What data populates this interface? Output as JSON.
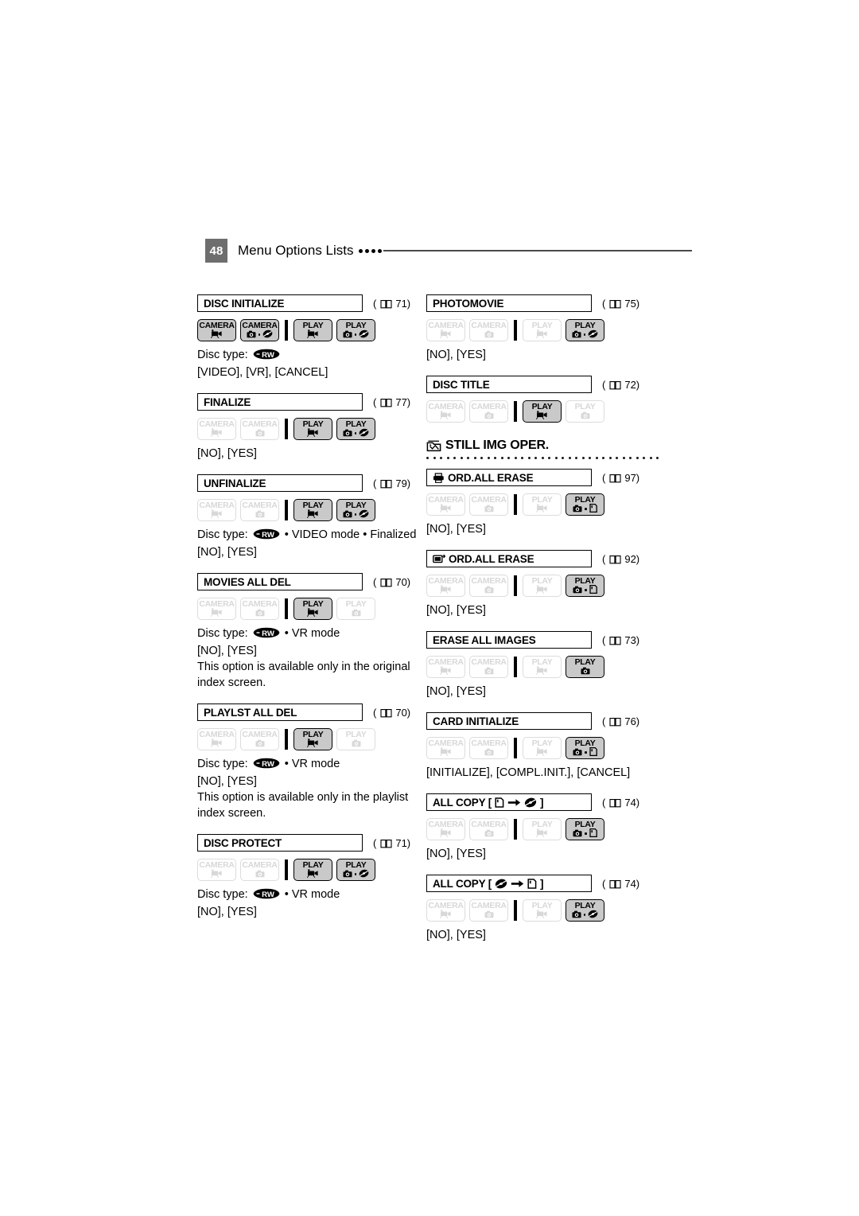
{
  "header": {
    "page_number": "48",
    "title": "Menu Options Lists",
    "dots": 4
  },
  "left_column": [
    {
      "id": "disc-initialize",
      "title": "DISC INITIALIZE",
      "ref": "71",
      "modes": [
        {
          "label": "CAMERA",
          "icons": [
            "movie"
          ],
          "enabled": true
        },
        {
          "label": "CAMERA",
          "icons": [
            "still",
            "disc"
          ],
          "enabled": true
        },
        {
          "label": "PLAY",
          "icons": [
            "movie"
          ],
          "enabled": true
        },
        {
          "label": "PLAY",
          "icons": [
            "still",
            "disc"
          ],
          "enabled": true
        }
      ],
      "lines": [
        {
          "type": "disctype",
          "prefix": "Disc type:",
          "disc": "-RW",
          "suffix": ""
        },
        {
          "type": "text",
          "text": "[VIDEO], [VR], [CANCEL]"
        }
      ]
    },
    {
      "id": "finalize",
      "title": "FINALIZE",
      "ref": "77",
      "modes": [
        {
          "label": "CAMERA",
          "icons": [
            "movie"
          ],
          "enabled": false
        },
        {
          "label": "CAMERA",
          "icons": [
            "still"
          ],
          "enabled": false
        },
        {
          "label": "PLAY",
          "icons": [
            "movie"
          ],
          "enabled": true
        },
        {
          "label": "PLAY",
          "icons": [
            "still",
            "disc"
          ],
          "enabled": true
        }
      ],
      "lines": [
        {
          "type": "text",
          "text": "[NO], [YES]"
        }
      ]
    },
    {
      "id": "unfinalize",
      "title": "UNFINALIZE",
      "ref": "79",
      "modes": [
        {
          "label": "CAMERA",
          "icons": [
            "movie"
          ],
          "enabled": false
        },
        {
          "label": "CAMERA",
          "icons": [
            "still"
          ],
          "enabled": false
        },
        {
          "label": "PLAY",
          "icons": [
            "movie"
          ],
          "enabled": true
        },
        {
          "label": "PLAY",
          "icons": [
            "still",
            "disc"
          ],
          "enabled": true
        }
      ],
      "lines": [
        {
          "type": "disctype",
          "prefix": "Disc type:",
          "disc": "-RW",
          "suffix": "• VIDEO mode • Finalized"
        },
        {
          "type": "text",
          "text": "[NO], [YES]"
        }
      ]
    },
    {
      "id": "movies-all-del",
      "title": "MOVIES ALL DEL",
      "ref": "70",
      "modes": [
        {
          "label": "CAMERA",
          "icons": [
            "movie"
          ],
          "enabled": false
        },
        {
          "label": "CAMERA",
          "icons": [
            "still"
          ],
          "enabled": false
        },
        {
          "label": "PLAY",
          "icons": [
            "movie"
          ],
          "enabled": true
        },
        {
          "label": "PLAY",
          "icons": [
            "still"
          ],
          "enabled": false
        }
      ],
      "lines": [
        {
          "type": "disctype",
          "prefix": "Disc type:",
          "disc": "-RW",
          "suffix": "• VR mode"
        },
        {
          "type": "text",
          "text": "[NO], [YES]"
        },
        {
          "type": "wrap",
          "text": "This option is available only in the original index screen."
        }
      ]
    },
    {
      "id": "playlst-all-del",
      "title": "PLAYLST ALL DEL",
      "ref": "70",
      "modes": [
        {
          "label": "CAMERA",
          "icons": [
            "movie"
          ],
          "enabled": false
        },
        {
          "label": "CAMERA",
          "icons": [
            "still"
          ],
          "enabled": false
        },
        {
          "label": "PLAY",
          "icons": [
            "movie"
          ],
          "enabled": true
        },
        {
          "label": "PLAY",
          "icons": [
            "still"
          ],
          "enabled": false
        }
      ],
      "lines": [
        {
          "type": "disctype",
          "prefix": "Disc type:",
          "disc": "-RW",
          "suffix": "• VR mode"
        },
        {
          "type": "text",
          "text": "[NO], [YES]"
        },
        {
          "type": "wrap",
          "text": "This option is available only in the playlist index screen."
        }
      ]
    },
    {
      "id": "disc-protect",
      "title": "DISC PROTECT",
      "ref": "71",
      "modes": [
        {
          "label": "CAMERA",
          "icons": [
            "movie"
          ],
          "enabled": false
        },
        {
          "label": "CAMERA",
          "icons": [
            "still"
          ],
          "enabled": false
        },
        {
          "label": "PLAY",
          "icons": [
            "movie"
          ],
          "enabled": true
        },
        {
          "label": "PLAY",
          "icons": [
            "still",
            "disc"
          ],
          "enabled": true
        }
      ],
      "lines": [
        {
          "type": "disctype",
          "prefix": "Disc type:",
          "disc": "-RW",
          "suffix": "• VR mode"
        },
        {
          "type": "text",
          "text": "[NO], [YES]"
        }
      ]
    }
  ],
  "right_column": [
    {
      "id": "photomovie",
      "title": "PHOTOMOVIE",
      "ref": "75",
      "modes": [
        {
          "label": "CAMERA",
          "icons": [
            "movie"
          ],
          "enabled": false
        },
        {
          "label": "CAMERA",
          "icons": [
            "still"
          ],
          "enabled": false
        },
        {
          "label": "PLAY",
          "icons": [
            "movie"
          ],
          "enabled": false
        },
        {
          "label": "PLAY",
          "icons": [
            "still",
            "disc"
          ],
          "enabled": true
        }
      ],
      "lines": [
        {
          "type": "text",
          "text": "[NO], [YES]"
        }
      ]
    },
    {
      "id": "disc-title",
      "title": "DISC TITLE",
      "ref": "72",
      "modes": [
        {
          "label": "CAMERA",
          "icons": [
            "movie"
          ],
          "enabled": false
        },
        {
          "label": "CAMERA",
          "icons": [
            "still"
          ],
          "enabled": false
        },
        {
          "label": "PLAY",
          "icons": [
            "movie"
          ],
          "enabled": true
        },
        {
          "label": "PLAY",
          "icons": [
            "still"
          ],
          "enabled": false
        }
      ],
      "lines": []
    }
  ],
  "still_img_section": {
    "title": "STILL IMG OPER.",
    "icon": "still-image-folder-icon",
    "entries": [
      {
        "id": "ord-all-erase-print",
        "title": "ORD.ALL ERASE",
        "title_icon": "print-order-icon",
        "ref": "97",
        "modes": [
          {
            "label": "CAMERA",
            "icons": [
              "movie"
            ],
            "enabled": false
          },
          {
            "label": "CAMERA",
            "icons": [
              "still"
            ],
            "enabled": false
          },
          {
            "label": "PLAY",
            "icons": [
              "movie"
            ],
            "enabled": false
          },
          {
            "label": "PLAY",
            "icons": [
              "still",
              "card"
            ],
            "enabled": true
          }
        ],
        "lines": [
          {
            "type": "text",
            "text": "[NO], [YES]"
          }
        ]
      },
      {
        "id": "ord-all-erase-transfer",
        "title": "ORD.ALL ERASE",
        "title_icon": "transfer-order-icon",
        "ref": "92",
        "modes": [
          {
            "label": "CAMERA",
            "icons": [
              "movie"
            ],
            "enabled": false
          },
          {
            "label": "CAMERA",
            "icons": [
              "still"
            ],
            "enabled": false
          },
          {
            "label": "PLAY",
            "icons": [
              "movie"
            ],
            "enabled": false
          },
          {
            "label": "PLAY",
            "icons": [
              "still",
              "card"
            ],
            "enabled": true
          }
        ],
        "lines": [
          {
            "type": "text",
            "text": "[NO], [YES]"
          }
        ]
      },
      {
        "id": "erase-all-images",
        "title": "ERASE ALL IMAGES",
        "title_icon": "",
        "ref": "73",
        "modes": [
          {
            "label": "CAMERA",
            "icons": [
              "movie"
            ],
            "enabled": false
          },
          {
            "label": "CAMERA",
            "icons": [
              "still"
            ],
            "enabled": false
          },
          {
            "label": "PLAY",
            "icons": [
              "movie"
            ],
            "enabled": false
          },
          {
            "label": "PLAY",
            "icons": [
              "still"
            ],
            "enabled": true
          }
        ],
        "lines": [
          {
            "type": "text",
            "text": "[NO], [YES]"
          }
        ]
      },
      {
        "id": "card-initialize",
        "title": "CARD INITIALIZE",
        "title_icon": "",
        "ref": "76",
        "modes": [
          {
            "label": "CAMERA",
            "icons": [
              "movie"
            ],
            "enabled": false
          },
          {
            "label": "CAMERA",
            "icons": [
              "still"
            ],
            "enabled": false
          },
          {
            "label": "PLAY",
            "icons": [
              "movie"
            ],
            "enabled": false
          },
          {
            "label": "PLAY",
            "icons": [
              "still",
              "card"
            ],
            "enabled": true
          }
        ],
        "lines": [
          {
            "type": "text",
            "text": "[INITIALIZE], [COMPL.INIT.], [CANCEL]"
          }
        ]
      },
      {
        "id": "all-copy-card-to-disc",
        "title": "ALL COPY [",
        "title_suffix": "]",
        "title_media": [
          "card",
          "arrow",
          "disc"
        ],
        "ref": "74",
        "modes": [
          {
            "label": "CAMERA",
            "icons": [
              "movie"
            ],
            "enabled": false
          },
          {
            "label": "CAMERA",
            "icons": [
              "still"
            ],
            "enabled": false
          },
          {
            "label": "PLAY",
            "icons": [
              "movie"
            ],
            "enabled": false
          },
          {
            "label": "PLAY",
            "icons": [
              "still",
              "card"
            ],
            "enabled": true
          }
        ],
        "lines": [
          {
            "type": "text",
            "text": "[NO], [YES]"
          }
        ]
      },
      {
        "id": "all-copy-disc-to-card",
        "title": "ALL COPY [",
        "title_suffix": "]",
        "title_media": [
          "disc",
          "arrow",
          "card"
        ],
        "ref": "74",
        "modes": [
          {
            "label": "CAMERA",
            "icons": [
              "movie"
            ],
            "enabled": false
          },
          {
            "label": "CAMERA",
            "icons": [
              "still"
            ],
            "enabled": false
          },
          {
            "label": "PLAY",
            "icons": [
              "movie"
            ],
            "enabled": false
          },
          {
            "label": "PLAY",
            "icons": [
              "still",
              "disc"
            ],
            "enabled": true
          }
        ],
        "lines": [
          {
            "type": "text",
            "text": "[NO], [YES]"
          }
        ]
      }
    ]
  },
  "colors": {
    "page_tab_bg": "#6e6e6e",
    "badge_on_bg": "#c9c9c9",
    "badge_off_fg": "#d8d8d8",
    "rule": "#4a4a4a"
  }
}
